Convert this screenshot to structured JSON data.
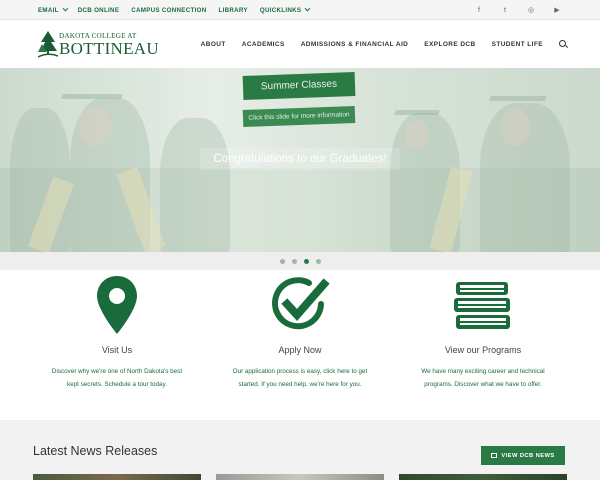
{
  "topbar": {
    "links": [
      {
        "label": "EMAIL",
        "dropdown": true
      },
      {
        "label": "DCB ONLINE",
        "dropdown": false
      },
      {
        "label": "CAMPUS CONNECTION",
        "dropdown": false
      },
      {
        "label": "LIBRARY",
        "dropdown": false
      },
      {
        "label": "QUICKLINKS",
        "dropdown": true
      }
    ],
    "social": [
      {
        "icon": "facebook-icon",
        "glyph": "f"
      },
      {
        "icon": "twitter-icon",
        "glyph": "t"
      },
      {
        "icon": "instagram-icon",
        "glyph": "◎"
      },
      {
        "icon": "youtube-icon",
        "glyph": "▶"
      }
    ]
  },
  "logo": {
    "line1": "DAKOTA COLLEGE AT",
    "line2": "BOTTINEAU"
  },
  "nav": {
    "items": [
      "ABOUT",
      "ACADEMICS",
      "ADMISSIONS & FINANCIAL AID",
      "EXPLORE DCB",
      "STUDENT LIFE"
    ]
  },
  "hero": {
    "slide_title": "Summer Classes",
    "slide_cta": "Click this slide for more information",
    "caption": "Congratulations to our Graduates!",
    "slide_count": 4,
    "active_slide": 3
  },
  "features": [
    {
      "icon": "map-pin-icon",
      "title": "Visit Us",
      "desc": "Discover why we're one of North Dakota's best kept secrets. Schedule a tour today."
    },
    {
      "icon": "checkmark-circle-icon",
      "title": "Apply Now",
      "desc": "Our application process is easy, click here to get started. If you need help, we're here for you."
    },
    {
      "icon": "books-icon",
      "title": "View our Programs",
      "desc": "We have many exciting career and technical programs. Discover what we have to offer."
    }
  ],
  "news": {
    "heading": "Latest News Releases",
    "button_label": "VIEW DCB NEWS"
  },
  "colors": {
    "brand_green": "#2a7a44",
    "link_green": "#1a6b3c"
  }
}
